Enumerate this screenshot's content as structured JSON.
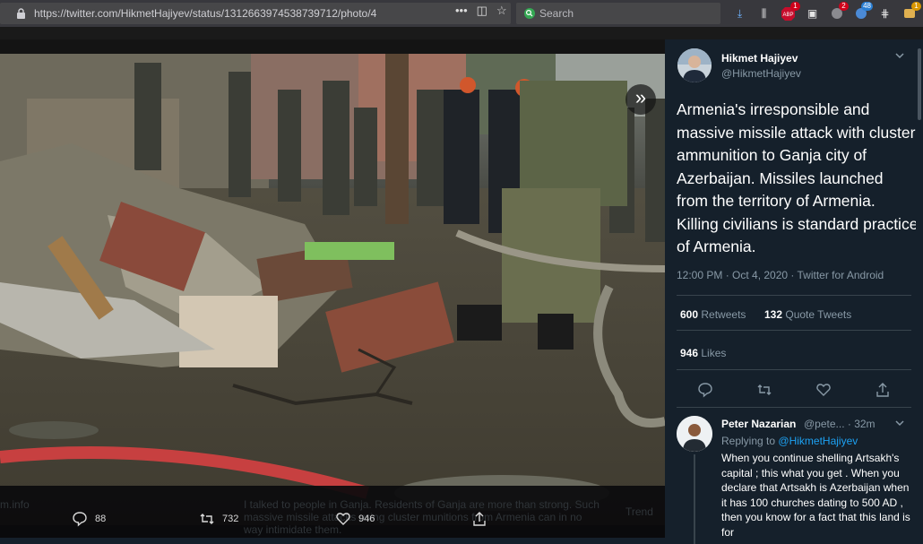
{
  "browser": {
    "url": "https://twitter.com/HikmetHajiyev/status/1312663974538739712/photo/4",
    "search_placeholder": "Search",
    "badges": [
      {
        "icon": "abp-icon",
        "count": "1",
        "color": "#d0021b"
      },
      {
        "icon": "extension-icon",
        "count": "2",
        "color": "#d0021b"
      },
      {
        "icon": "extension-icon-2",
        "count": "48",
        "color": "#2a7fd4"
      },
      {
        "icon": "extension-icon-3",
        "count": "1",
        "color": "#d89600"
      }
    ]
  },
  "photo_actions": {
    "reply_count": "88",
    "retweet_count": "732",
    "like_count": "946"
  },
  "background_page": {
    "ghost_line_1": "I talked to people in Ganja. Residents of Ganja are more than strong. Such",
    "ghost_line_2": "massive missile attacks using cluster munitions from Armenia can in no",
    "ghost_line_3": "way intimidate them.",
    "ghost_left": "m.info",
    "ghost_right": "Trend"
  },
  "tweet": {
    "author_name": "Hikmet Hajiyev",
    "author_handle": "@HikmetHajiyev",
    "text": "Armenia's irresponsible and massive missile attack with cluster ammunition to Ganja city of Azerbaijan. Missiles launched from the territory of Armenia. Killing civilians is standard practice of Armenia.",
    "meta": "12:00 PM · Oct 4, 2020 · Twitter for Android",
    "retweets_count": "600",
    "retweets_label": "Retweets",
    "quotes_count": "132",
    "quotes_label": "Quote Tweets",
    "likes_count": "946",
    "likes_label": "Likes"
  },
  "reply": {
    "author_name": "Peter Nazarian",
    "author_handle": "@pete... · 32m",
    "replying_prefix": "Replying to",
    "replying_to": "@HikmetHajiyev",
    "text": "When you continue shelling Artsakh's capital ; this what you get . When you declare that Artsakh is Azerbaijan when it has 100 churches dating to 500 AD , then you know for a fact that this land is for"
  },
  "colors": {
    "panel_bg": "#15202b",
    "accent": "#1da1f2",
    "muted": "#8899a6"
  }
}
